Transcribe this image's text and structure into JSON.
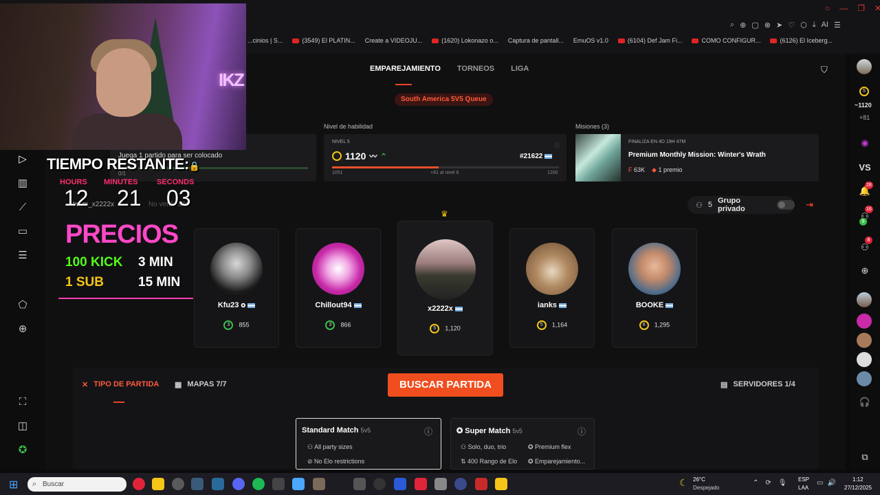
{
  "browser": {
    "bookmarks": [
      "...cinios | S...",
      "(3549) El PLATIN...",
      "Create a VIDEOJU...",
      "(1620) Lokonazo o...",
      "Captura de pantall...",
      "EmuOS v1.0",
      "(6104) Def Jam Fi...",
      "COMO CONFIGUR...",
      "(6126) El Iceberg..."
    ],
    "ai_label": "AI"
  },
  "nav": {
    "tabs": [
      "EMPAREJAMIENTO",
      "TORNEOS",
      "LIGA"
    ]
  },
  "queue": "South America 5V5 Queue",
  "placement": {
    "text": "Juega 1 partido para ser colocado",
    "progress": "0/1",
    "team": "team_x2222x",
    "verified": "No verificado"
  },
  "skill": {
    "section_label": "Nivel de habilidad",
    "level_label": "NIVEL 5",
    "elo": "1120",
    "rank": "#21622",
    "min": "1051",
    "max": "1200",
    "to_next": "+81 al nivel 6",
    "progress_fraction": 0.47
  },
  "missions": {
    "section_label": "Misiones (3)",
    "ends": "FINALIZA EN 4D 19H 47M",
    "title": "Premium Monthly Mission: Winter's Wrath",
    "points": "63K",
    "reward": "1 premio"
  },
  "group": {
    "count": "5",
    "label": "Grupo privado"
  },
  "players": [
    {
      "name": "Kfu23",
      "level": "3",
      "elo": "855"
    },
    {
      "name": "Chillout94",
      "level": "3",
      "elo": "866"
    },
    {
      "name": "x2222x",
      "level": "5",
      "elo": "1,120"
    },
    {
      "name": "ianks",
      "level": "5",
      "elo": "1,164"
    },
    {
      "name": "BOOKE",
      "level": "6",
      "elo": "1,295"
    }
  ],
  "bottom": {
    "tipo": "TIPO DE PARTIDA",
    "mapas": "MAPAS 7/7",
    "buscar": "BUSCAR PARTIDA",
    "servidores": "SERVIDORES 1/4"
  },
  "matches": {
    "standard": {
      "title": "Standard Match",
      "mode": "5v5",
      "line1": "All party sizes",
      "line2": "No Elo restrictions"
    },
    "super": {
      "title": "Super Match",
      "mode": "5v5",
      "line1": "Solo, duo, trio",
      "line2": "400 Rango de Elo",
      "line3": "Premium flex",
      "line4": "Emparejamiento..."
    }
  },
  "overlay": {
    "title": "TIEMPO RESTANTE:",
    "labels": [
      "HOURS",
      "MINUTES",
      "SECONDS"
    ],
    "values": [
      "12",
      "21",
      "03"
    ],
    "precios": "PRECIOS",
    "row1_left": "100 KICK",
    "row1_right": "3 MIN",
    "row2_left": "1 SUB",
    "row2_right": "15 MIN"
  },
  "right_sidebar": {
    "level": "5",
    "elo": "1120",
    "delta": "+81",
    "vs": "VS",
    "badge1": "28",
    "badge2": "16",
    "badge3": "9",
    "badge4": "8"
  },
  "taskbar": {
    "search": "Buscar",
    "temp": "26°C",
    "weather": "Despejado",
    "lang1": "ESP",
    "lang2": "LAA",
    "time": "1:12",
    "date": "27/12/2025"
  },
  "colors": {
    "accent": "#f04e1e",
    "precios": "#ff48c8",
    "kick": "#53fc18",
    "sub": "#f5c518"
  }
}
